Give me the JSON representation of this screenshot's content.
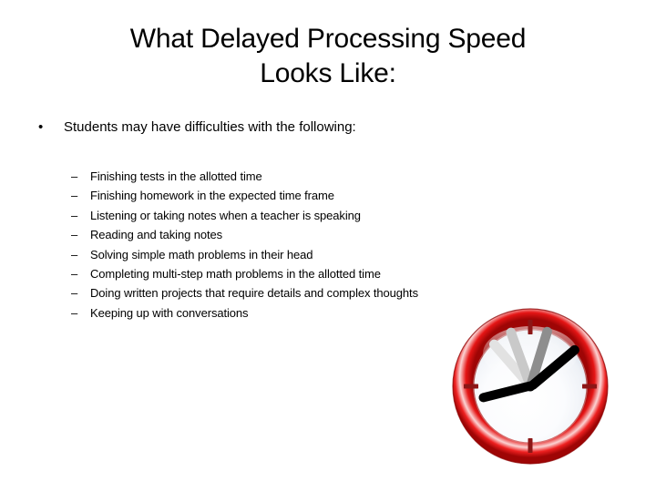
{
  "slide": {
    "background_color": "#ffffff",
    "title": {
      "line1": "What Delayed Processing Speed",
      "line2": "Looks Like:"
    },
    "bullet_level1": {
      "marker": "•",
      "text": "Students may have difficulties with the following:"
    },
    "sublist": {
      "marker": "–",
      "items": [
        {
          "text": "Finishing tests in the allotted time"
        },
        {
          "text": "Finishing homework in the expected time frame"
        },
        {
          "text": "Listening or taking notes when a teacher is speaking"
        },
        {
          "text": "Reading and taking notes"
        },
        {
          "text": "Solving simple math problems in their head"
        },
        {
          "text": "Completing multi-step math problems in the allotted time"
        },
        {
          "text": "Doing written projects that require details and complex thoughts"
        },
        {
          "text": "Keeping up with conversations"
        }
      ]
    },
    "clock": {
      "name": "clock-image",
      "bezel_outer_color": "#9e0505",
      "bezel_bright_color": "#e51515",
      "bezel_highlight_color": "#fbd3d3",
      "face_color": "#fdfdfe",
      "face_edge_color": "#dfe4ec",
      "tick_color": "#8c1616",
      "hand_color": "#000000",
      "ghost_hand_colors": [
        "#e2e2e2",
        "#c9c9c9",
        "#8e8e8e"
      ],
      "tick_positions": [
        "12",
        "3",
        "6",
        "9"
      ]
    }
  }
}
